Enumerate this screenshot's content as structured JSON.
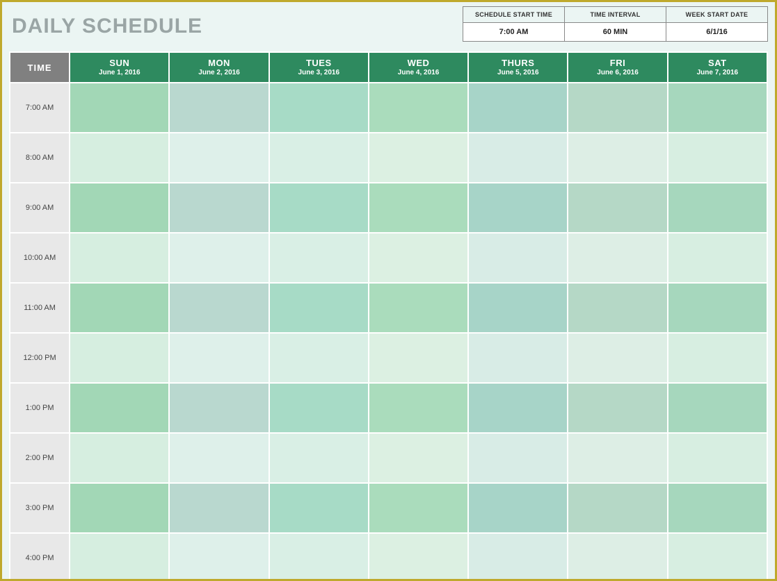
{
  "title": "DAILY SCHEDULE",
  "params": [
    {
      "label": "SCHEDULE START TIME",
      "value": "7:00 AM"
    },
    {
      "label": "TIME INTERVAL",
      "value": "60 MIN"
    },
    {
      "label": "WEEK START DATE",
      "value": "6/1/16"
    }
  ],
  "time_header": "TIME",
  "days": [
    {
      "abbr": "SUN",
      "date": "June 1, 2016"
    },
    {
      "abbr": "MON",
      "date": "June 2, 2016"
    },
    {
      "abbr": "TUES",
      "date": "June 3, 2016"
    },
    {
      "abbr": "WED",
      "date": "June 4, 2016"
    },
    {
      "abbr": "THURS",
      "date": "June 5, 2016"
    },
    {
      "abbr": "FRI",
      "date": "June 6, 2016"
    },
    {
      "abbr": "SAT",
      "date": "June 7, 2016"
    }
  ],
  "times": [
    "7:00 AM",
    "8:00 AM",
    "9:00 AM",
    "10:00 AM",
    "11:00 AM",
    "12:00 PM",
    "1:00 PM",
    "2:00 PM",
    "3:00 PM",
    "4:00 PM"
  ]
}
